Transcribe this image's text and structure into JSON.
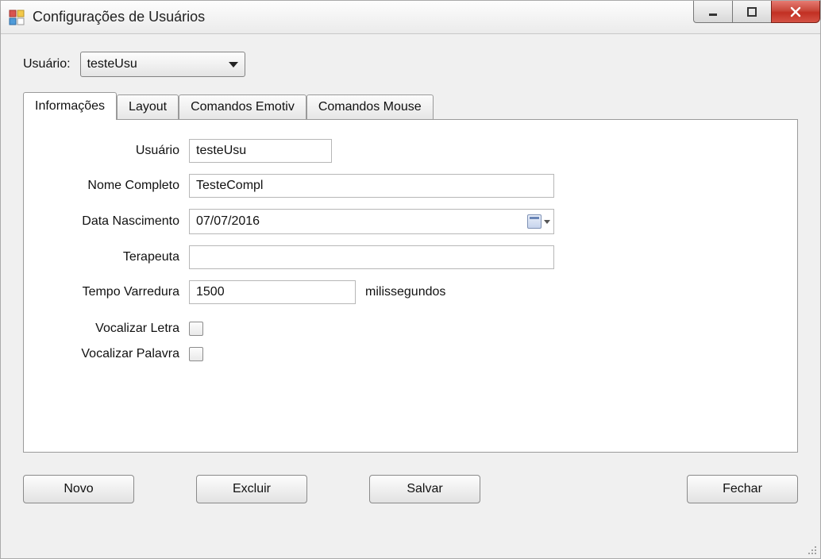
{
  "window": {
    "title": "Configurações de Usuários"
  },
  "top": {
    "user_label": "Usuário:",
    "user_selected": "testeUsu"
  },
  "tabs": {
    "informacoes": "Informações",
    "layout": "Layout",
    "comandos_emotiv": "Comandos Emotiv",
    "comandos_mouse": "Comandos Mouse"
  },
  "form": {
    "usuario_label": "Usuário",
    "usuario_value": "testeUsu",
    "nome_label": "Nome Completo",
    "nome_value": "TesteCompl",
    "data_label": "Data Nascimento",
    "data_value": "07/07/2016",
    "terapeuta_label": "Terapeuta",
    "terapeuta_value": "",
    "tempo_label": "Tempo Varredura",
    "tempo_value": "1500",
    "tempo_unit": "milissegundos",
    "voc_letra_label": "Vocalizar Letra",
    "voc_letra_checked": false,
    "voc_palavra_label": "Vocalizar Palavra",
    "voc_palavra_checked": false
  },
  "buttons": {
    "novo": "Novo",
    "excluir": "Excluir",
    "salvar": "Salvar",
    "fechar": "Fechar"
  }
}
